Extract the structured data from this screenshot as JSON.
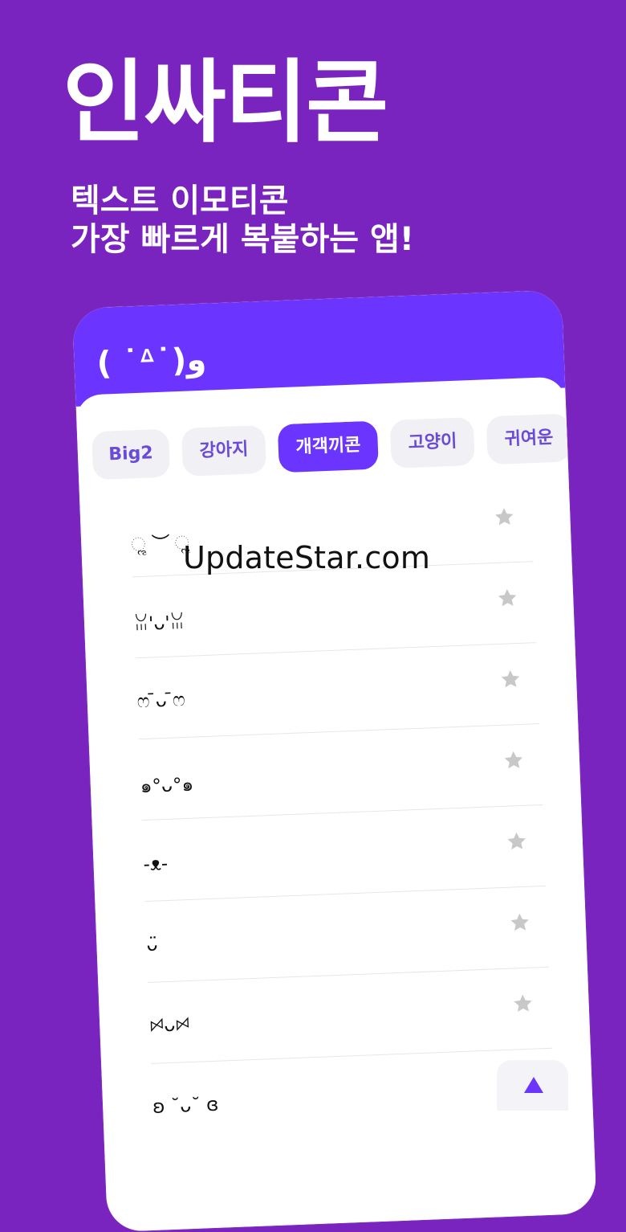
{
  "promo": {
    "title": "인싸티콘",
    "subtitle_line1": "텍스트 이모티콘",
    "subtitle_line2": "가장 빠르게 복붙하는 앱!"
  },
  "header": {
    "emoticon": "( ˙ᐞ˙)و"
  },
  "tabs": [
    {
      "label": "Big2",
      "active": false
    },
    {
      "label": "강아지",
      "active": false
    },
    {
      "label": "개객끼콘",
      "active": true
    },
    {
      "label": "고양이",
      "active": false
    },
    {
      "label": "귀여운",
      "active": false
    }
  ],
  "emoticons": [
    "ૢ ︶ ૢ",
    "ꈍ'ᴗ'ꈍ",
    "ෆ ̄ᴗ ̄ෆ",
    "๑°ᴗ°๑",
    "-ᴥ-",
    "ᴗ̈",
    "ꗯᴗꗯ",
    "ʚ ˘ᴗ˘ ɞ"
  ],
  "watermark": "UpdateStar.com",
  "icons": {
    "favorite": "star-icon",
    "scroll_top": "arrow-up-icon"
  },
  "colors": {
    "background": "#7a24bf",
    "accent": "#6b35ff",
    "tab_background": "#f1f0f5",
    "star": "#c8c8c8"
  }
}
